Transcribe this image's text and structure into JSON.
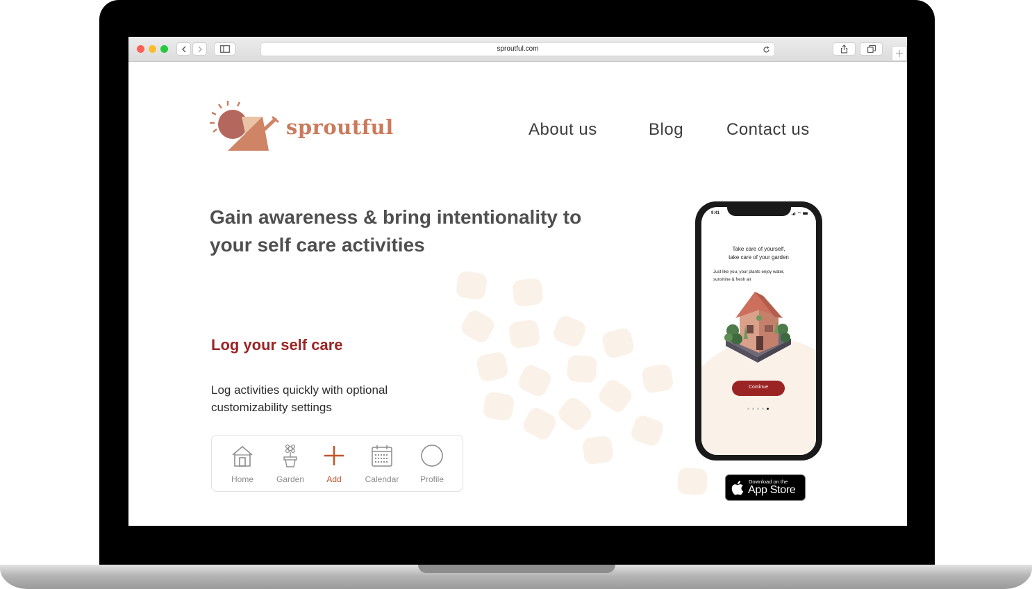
{
  "browser": {
    "url": "sproutful.com",
    "buttons": [
      "back",
      "forward",
      "sidebar",
      "reload",
      "share",
      "tabs",
      "new-tab"
    ]
  },
  "header": {
    "brand": "sproutful",
    "nav": [
      "About us",
      "Blog",
      "Contact us"
    ]
  },
  "hero": {
    "headline_line1": "Gain awareness & bring intentionality to",
    "headline_line2": "your self care activities"
  },
  "feature": {
    "title": "Log your self care",
    "description_line1": "Log activities quickly with optional",
    "description_line2": "customizability settings",
    "tabs": [
      {
        "label": "Home",
        "icon": "house-icon"
      },
      {
        "label": "Garden",
        "icon": "potted-plant-icon"
      },
      {
        "label": "Add",
        "icon": "plus-icon"
      },
      {
        "label": "Calendar",
        "icon": "calendar-icon"
      },
      {
        "label": "Profile",
        "icon": "circle-icon"
      }
    ]
  },
  "phone": {
    "time": "9:41",
    "title_line1": "Take care of yourself,",
    "title_line2": "take care of your garden",
    "body_line1": "Just like you, your plants enjoy water,",
    "body_line2": "sunshine & fresh air",
    "cta": "Continue",
    "pager": {
      "count": 5,
      "active": 5
    }
  },
  "app_store": {
    "small": "Download on the",
    "large": "App Store"
  },
  "colors": {
    "brand": "#c97b5c",
    "accent_red": "#9a2424",
    "add_orange": "#c0562c",
    "blob": "#faf1e8",
    "text_gray": "#4f4f4f"
  }
}
